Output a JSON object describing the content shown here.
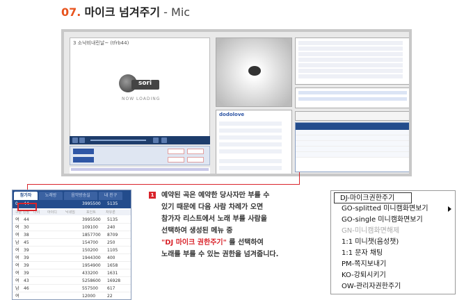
{
  "heading": {
    "number": "07.",
    "text": "마이크 넘겨주기",
    "suffix": "- Mic"
  },
  "video": {
    "title": "3 소낙비내린날~ (tfrb44)",
    "logo_text": "sori",
    "loading": "NOW LOADING"
  },
  "user_panel": {
    "name": "dodolove"
  },
  "participant_list": {
    "tabs": [
      "참가자",
      "노래방",
      "음악방송실",
      "내 친구"
    ],
    "me_row": {
      "room": "0",
      "no": "44",
      "id": "",
      "value1": "3995500",
      "value2": "5135"
    },
    "header": [
      "구분 성별",
      "나이",
      "아이디",
      "닉네임",
      "포인트",
      "자유론"
    ],
    "rows": [
      {
        "tag": "여",
        "age": "44",
        "p1": "3995500",
        "p2": "5135"
      },
      {
        "tag": "여",
        "age": "30",
        "p1": "109100",
        "p2": "240"
      },
      {
        "tag": "여",
        "age": "38",
        "p1": "1857700",
        "p2": "8709"
      },
      {
        "tag": "남",
        "age": "45",
        "p1": "154700",
        "p2": "250"
      },
      {
        "tag": "여",
        "age": "39",
        "p1": "150200",
        "p2": "1105"
      },
      {
        "tag": "여",
        "age": "39",
        "p1": "1944300",
        "p2": "400"
      },
      {
        "tag": "여",
        "age": "39",
        "p1": "1954900",
        "p2": "1658"
      },
      {
        "tag": "여",
        "age": "39",
        "p1": "433200",
        "p2": "1631"
      },
      {
        "tag": "여",
        "age": "43",
        "p1": "5258600",
        "p2": "16928"
      },
      {
        "tag": "남",
        "age": "46",
        "p1": "557500",
        "p2": "617"
      },
      {
        "tag": "여",
        "age": "",
        "p1": "12000",
        "p2": "22"
      }
    ]
  },
  "callout": {
    "badge": "1",
    "line1": "예약된 곡은 예약한 당사자만 부를 수",
    "line2": "있기 때문에 다음 사람 차례가 오면",
    "line3": "참가자 리스트에서 노래 부를 사람을",
    "line4": "선택하여 생성된 메뉴 중",
    "line5_highlight": "\"DJ 마이크 권한주기\"",
    "line5_rest": " 를 선택하여",
    "line6": "노래를 부를 수 있는 권한을 넘겨줍니다."
  },
  "context_menu": {
    "items": [
      {
        "label": "DJ-마이크권한주기",
        "state": "selected"
      },
      {
        "label": "GO-splitted 미니캠화면보기",
        "state": "submenu"
      },
      {
        "label": "GO-single  미니캠화면보기",
        "state": "normal"
      },
      {
        "label": "GN-미니캠화면해제",
        "state": "disabled"
      },
      {
        "label": "1:1 미니챗(음성챗)",
        "state": "normal"
      },
      {
        "label": "1:1 문자 채팅",
        "state": "normal"
      },
      {
        "label": "PM-쪽지보내기",
        "state": "normal"
      },
      {
        "label": "KO-강퇴시키기",
        "state": "normal"
      },
      {
        "label": "OW-관리자권한주기",
        "state": "normal"
      }
    ]
  },
  "colors": {
    "accent": "#e8541e",
    "highlight": "#d9232a",
    "nav": "#234c8c"
  }
}
